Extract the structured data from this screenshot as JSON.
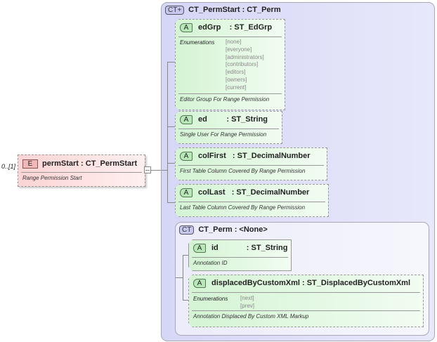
{
  "element": {
    "occurs": "0..[1]",
    "badge": "E",
    "name": "permStart",
    "type": ": CT_PermStart",
    "doc": "Range Permission Start"
  },
  "complex_type": {
    "badge": "CT+",
    "title": "CT_PermStart : CT_Perm"
  },
  "attributes": [
    {
      "badge": "A",
      "name": "edGrp",
      "type": ": ST_EdGrp",
      "enum_label": "Enumerations",
      "enums": [
        "[none]",
        "[everyone]",
        "[administrators]",
        "[contributors]",
        "[editors]",
        "[owners]",
        "[current]"
      ],
      "doc": "Editor Group For Range Permission"
    },
    {
      "badge": "A",
      "name": "ed",
      "type": ": ST_String",
      "doc": "Single User For Range Permission"
    },
    {
      "badge": "A",
      "name": "colFirst",
      "type": ": ST_DecimalNumber",
      "doc": "First Table Column Covered By Range Permission"
    },
    {
      "badge": "A",
      "name": "colLast",
      "type": ": ST_DecimalNumber",
      "doc": "Last Table Column Covered By Range Permission"
    }
  ],
  "base_type": {
    "badge": "CT",
    "title": "CT_Perm : <None>",
    "attributes": [
      {
        "badge": "A",
        "name": "id",
        "type": ": ST_String",
        "doc": "Annotation ID"
      },
      {
        "badge": "A",
        "name": "displacedByCustomXml",
        "type": ": ST_DisplacedByCustomXml",
        "enum_label": "Enumerations",
        "enums": [
          "[next]",
          "[prev]"
        ],
        "doc": "Annotation Displaced By Custom XML Markup"
      }
    ]
  }
}
